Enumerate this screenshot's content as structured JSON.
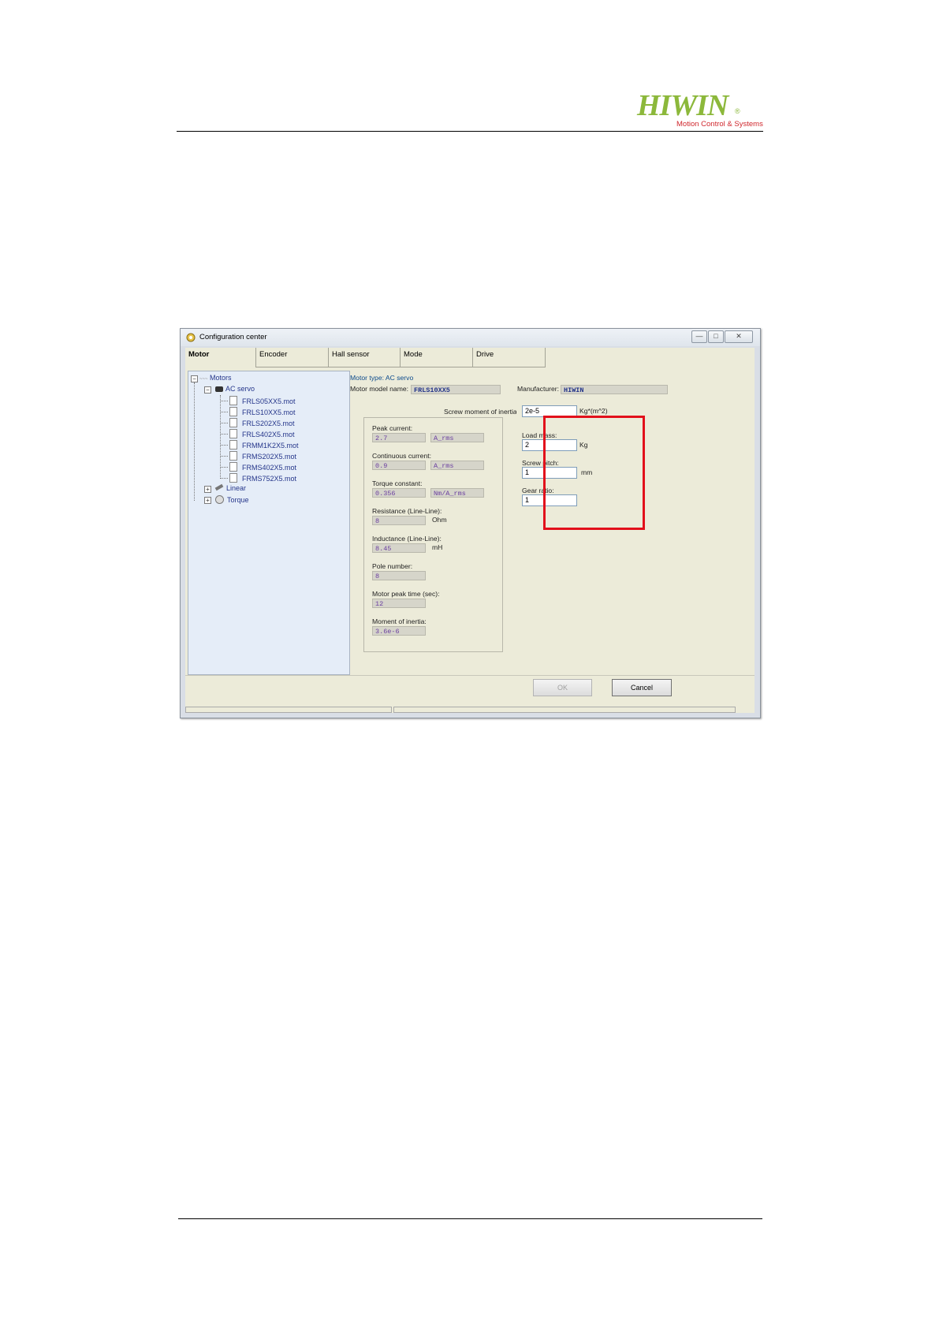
{
  "header": {
    "logo_text": "HIWIN",
    "logo_reg": "®",
    "logo_sub": "Motion Control & Systems"
  },
  "window": {
    "title": "Configuration center",
    "controls": {
      "minimize": "—",
      "maximize": "□",
      "close": "✕"
    },
    "tabs": [
      {
        "label": "Motor",
        "active": true
      },
      {
        "label": "Encoder"
      },
      {
        "label": "Hall sensor"
      },
      {
        "label": "Mode"
      },
      {
        "label": "Drive"
      }
    ],
    "tree": {
      "root": "Motors",
      "ac_servo": "AC servo",
      "files": [
        "FRLS05XX5.mot",
        "FRLS10XX5.mot",
        "FRLS202X5.mot",
        "FRLS402X5.mot",
        "FRMM1K2X5.mot",
        "FRMS202X5.mot",
        "FRMS402X5.mot",
        "FRMS752X5.mot"
      ],
      "linear": "Linear",
      "torque": "Torque"
    },
    "motor": {
      "type_label": "Motor type: AC servo",
      "model_label": "Motor model name:",
      "model_value": "FRLS10XX5",
      "manufacturer_label": "Manufacturer:",
      "manufacturer_value": "HIWIN",
      "screw_moi_label": "Screw moment of inertia:",
      "peak_current_label": "Peak current:",
      "peak_current_value": "2.7",
      "peak_current_unit": "A_rms",
      "continuous_current_label": "Continuous current:",
      "continuous_current_value": "0.9",
      "continuous_current_unit": "A_rms",
      "torque_constant_label": "Torque constant:",
      "torque_constant_value": "0.356",
      "torque_constant_unit": "Nm/A_rms",
      "resistance_label": "Resistance (Line-Line):",
      "resistance_value": "8",
      "resistance_unit": "Ohm",
      "inductance_label": "Inductance (Line-Line):",
      "inductance_value": "8.45",
      "inductance_unit": "mH",
      "pole_number_label": "Pole number:",
      "pole_number_value": "8",
      "peak_time_label": "Motor peak time (sec):",
      "peak_time_value": "12",
      "moi_label": "Moment of inertia:",
      "moi_value": "3.6e-6"
    },
    "load": {
      "screw_moi_value": "2e-5",
      "screw_moi_unit": "Kg*(m^2)",
      "load_mass_label": "Load mass:",
      "load_mass_value": "2",
      "load_mass_unit": "Kg",
      "screw_pitch_label": "Screw pitch:",
      "screw_pitch_value": "1",
      "screw_pitch_unit": "mm",
      "gear_ratio_label": "Gear ratio:",
      "gear_ratio_value": "1"
    },
    "buttons": {
      "ok": "OK",
      "cancel": "Cancel"
    }
  },
  "colors": {
    "highlight": "#e2101b",
    "logo_green": "#8cb83b",
    "logo_red": "#d0272d"
  }
}
